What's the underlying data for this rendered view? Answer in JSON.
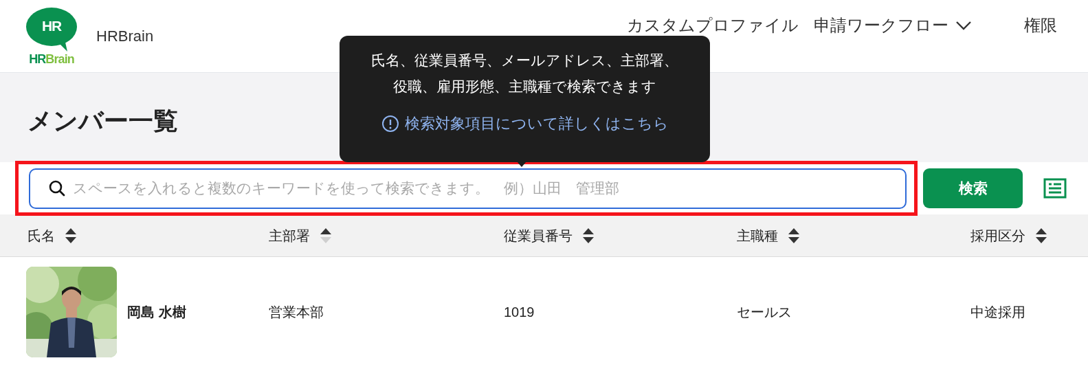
{
  "header": {
    "logo": {
      "badge": "HR",
      "wordmark": [
        "HR",
        "Brain"
      ]
    },
    "brand": "HRBrain",
    "nav": [
      {
        "label": "カスタムプロファイル",
        "dropdown": false
      },
      {
        "label": "申請ワークフロー",
        "dropdown": true
      },
      {
        "label": "権限",
        "dropdown": false
      }
    ]
  },
  "tooltip": {
    "lines": [
      "氏名、従業員番号、メールアドレス、主部署、",
      "役職、雇用形態、主職種で検索できます"
    ],
    "link": "検索対象項目について詳しくはこちら"
  },
  "page_title": "メンバー一覧",
  "search": {
    "placeholder": "スペースを入れると複数のキーワードを使って検索できます。　例）山田　管理部",
    "highlighted": true,
    "button": "検索"
  },
  "table": {
    "columns": [
      {
        "label": "氏名",
        "sorted": false
      },
      {
        "label": "主部署",
        "sorted": true
      },
      {
        "label": "従業員番号",
        "sorted": false
      },
      {
        "label": "主職種",
        "sorted": false
      },
      {
        "label": "採用区分",
        "sorted": false
      }
    ],
    "rows": [
      {
        "cells": [
          "岡島 水樹",
          "営業本部",
          "1019",
          "セールス",
          "中途採用"
        ]
      }
    ]
  }
}
